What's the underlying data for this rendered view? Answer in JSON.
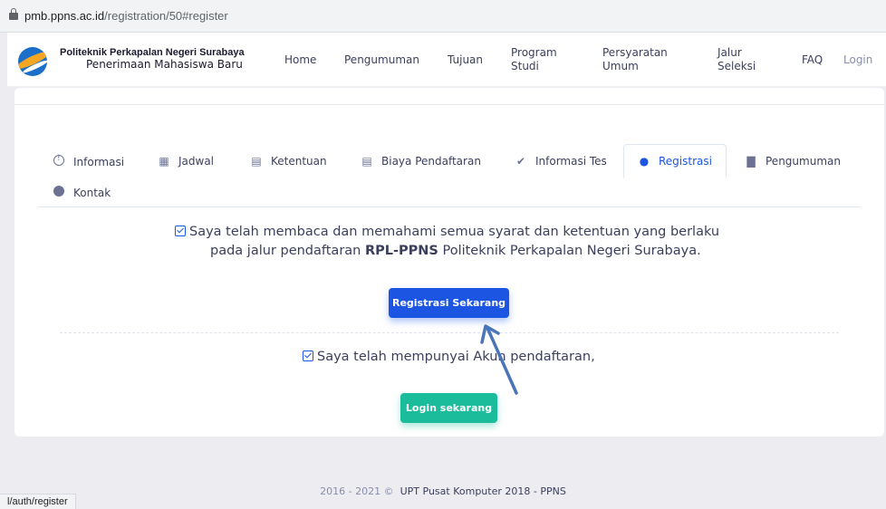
{
  "browser": {
    "url_host": "pmb.ppns.ac.id",
    "url_path": "/registration/50#register",
    "status_url": "l/auth/register"
  },
  "header": {
    "title_line1": "Politeknik Perkapalan Negeri Surabaya",
    "title_line2": "Penerimaan Mahasiswa Baru",
    "nav": {
      "home": "Home",
      "pengumuman": "Pengumuman",
      "tujuan": "Tujuan",
      "program_l1": "Program",
      "program_l2": "Studi",
      "persyaratan_l1": "Persyaratan",
      "persyaratan_l2": "Umum",
      "jalur_l1": "Jalur",
      "jalur_l2": "Seleksi",
      "faq": "FAQ",
      "login": "Login"
    }
  },
  "tabs": [
    {
      "label": "Informasi",
      "icon": "info-circle-icon"
    },
    {
      "label": "Jadwal",
      "icon": "calendar-icon"
    },
    {
      "label": "Ketentuan",
      "icon": "document-icon"
    },
    {
      "label": "Biaya Pendaftaran",
      "icon": "receipt-icon"
    },
    {
      "label": "Informasi Tes",
      "icon": "check-icon"
    },
    {
      "label": "Registrasi",
      "icon": "user-icon",
      "active": true
    },
    {
      "label": "Pengumuman",
      "icon": "file-icon"
    },
    {
      "label": "Kontak",
      "icon": "phone-icon"
    }
  ],
  "register": {
    "stmt1_line1": "Saya telah membaca dan memahami semua syarat dan ketentuan yang berlaku",
    "stmt1_line2_pre": "pada jalur pendaftaran ",
    "stmt1_line2_bold": "RPL-PPNS",
    "stmt1_line2_post": " Politeknik Perkapalan Negeri Surabaya.",
    "register_button": "Registrasi Sekarang",
    "stmt2": "Saya telah mempunyai Akun pendaftaran,",
    "login_button": "Login sekarang"
  },
  "footer": {
    "years": "2016 - 2021 ©",
    "org": "UPT Pusat Komputer 2018 - PPNS"
  },
  "colors": {
    "primary": "#1b55e2",
    "teal": "#1abc9c",
    "background": "#ececf1",
    "arrow": "#4a76b8"
  }
}
